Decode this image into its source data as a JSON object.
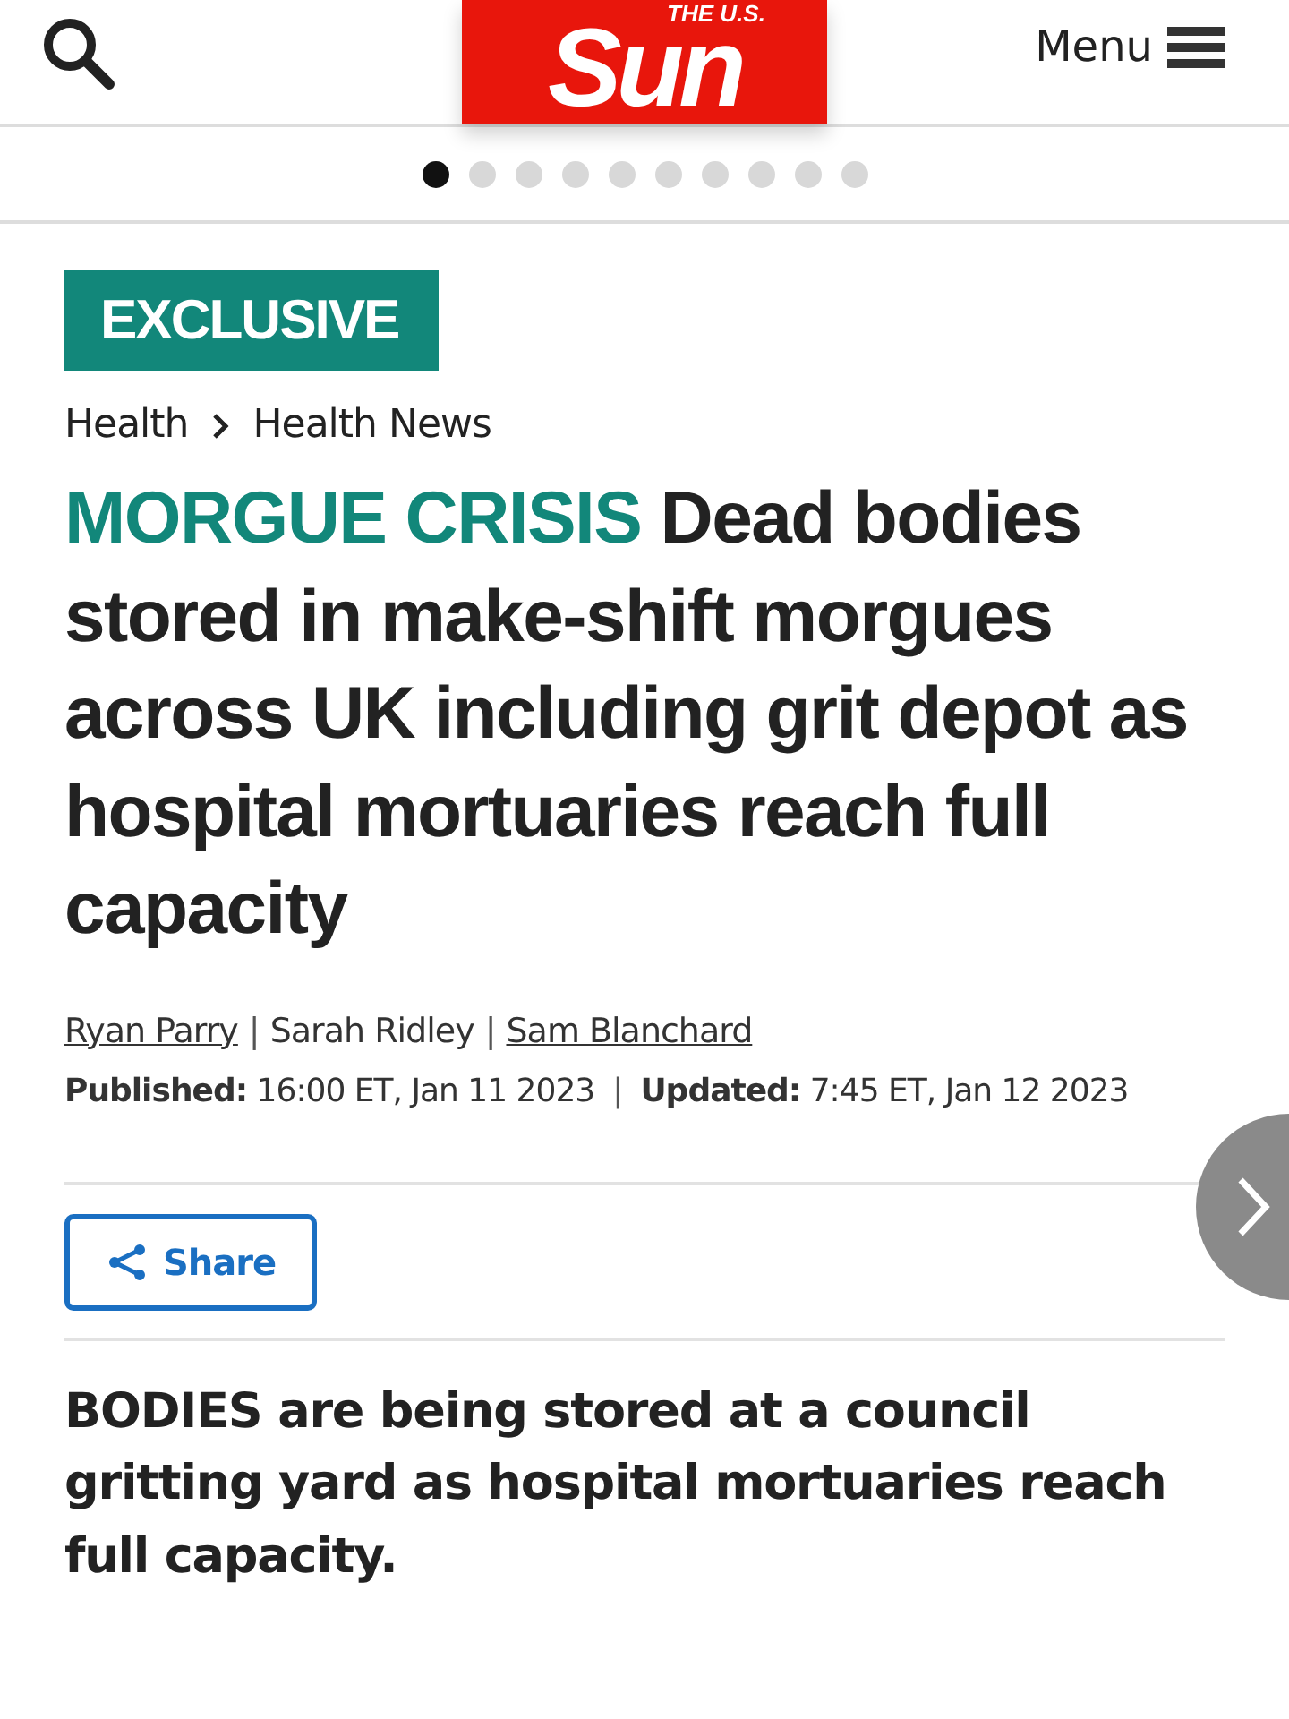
{
  "header": {
    "logo": {
      "top": "THE U.S.",
      "main": "Sun"
    },
    "menu_label": "Menu"
  },
  "carousel_dots": [
    {
      "selected": true
    },
    {
      "selected": false
    },
    {
      "selected": false
    },
    {
      "selected": false
    },
    {
      "selected": false
    },
    {
      "selected": false
    },
    {
      "selected": false
    },
    {
      "selected": false
    },
    {
      "selected": false
    },
    {
      "selected": false
    }
  ],
  "badge": "EXCLUSIVE",
  "breadcrumb": [
    {
      "label": "Health"
    },
    {
      "label": "Health News"
    }
  ],
  "headline": {
    "kicker": "MORGUE CRISIS",
    "text": "Dead bodies stored in make-shift morgues across UK including grit depot as hospital mortuaries reach full capacity"
  },
  "byline": {
    "separator": "|",
    "authors": [
      {
        "name": "Ryan Parry",
        "linked": true
      },
      {
        "name": "Sarah Ridley",
        "linked": false
      },
      {
        "name": "Sam Blanchard",
        "linked": true
      }
    ]
  },
  "dates": [
    {
      "label": "Published:",
      "value": "16:00 ET, Jan 11 2023"
    },
    {
      "label": "Updated:",
      "value": "7:45 ET, Jan 12 2023"
    }
  ],
  "share_button": "Share",
  "lead": "BODIES are being stored at a council gritting yard as hospital mortuaries reach full capacity."
}
